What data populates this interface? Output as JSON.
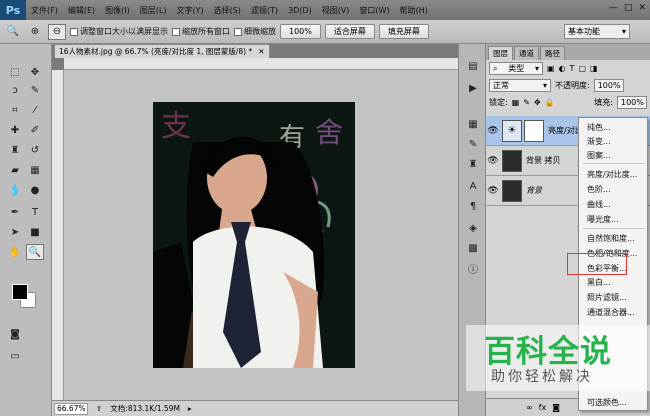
{
  "app": {
    "logo": "Ps"
  },
  "menu": [
    "文件(F)",
    "编辑(E)",
    "图像(I)",
    "图层(L)",
    "文字(Y)",
    "选择(S)",
    "滤镜(T)",
    "3D(D)",
    "视图(V)",
    "窗口(W)",
    "帮助(H)"
  ],
  "window_controls": [
    "—",
    "□",
    "✕"
  ],
  "options": {
    "resize_windows": "调整窗口大小以满屏显示",
    "zoom_all": "缩放所有窗口",
    "scrubby_zoom": "细微缩放",
    "zoom_value": "100%",
    "fit_screen": "适合屏幕",
    "fill_screen": "填充屏幕"
  },
  "workspace": "基本功能",
  "document": {
    "tab_title": "16人物素材.jpg @ 66.7% (亮度/对比度 1, 图层蒙版/8) *",
    "zoom": "66.67%",
    "doc_size": "文档:813.1K/1.59M"
  },
  "panels": {
    "tabs": [
      "图层",
      "通道",
      "路径"
    ],
    "filter_kind": "类型",
    "blend_mode": "正常",
    "opacity_label": "不透明度:",
    "opacity_value": "100%",
    "lock_label": "锁定:",
    "fill_label": "填充:",
    "fill_value": "100%",
    "layers": [
      {
        "name": "亮度/对比度 1"
      },
      {
        "name": "背景 拷贝"
      },
      {
        "name": "背景"
      }
    ]
  },
  "context_menu": {
    "items": [
      "纯色...",
      "渐变...",
      "图案...",
      "亮度/对比度...",
      "色阶...",
      "曲线...",
      "曝光度...",
      "自然饱和度...",
      "色相/饱和度...",
      "色彩平衡...",
      "黑白...",
      "照片滤镜...",
      "通道混合器...",
      "可选颜色..."
    ],
    "highlighted": "色彩平衡..."
  },
  "watermark": {
    "title": "百科全说",
    "subtitle": "助你轻松解决"
  },
  "colors": {
    "highlight_border": "#e03a3a",
    "watermark_green": "#26b34b"
  }
}
